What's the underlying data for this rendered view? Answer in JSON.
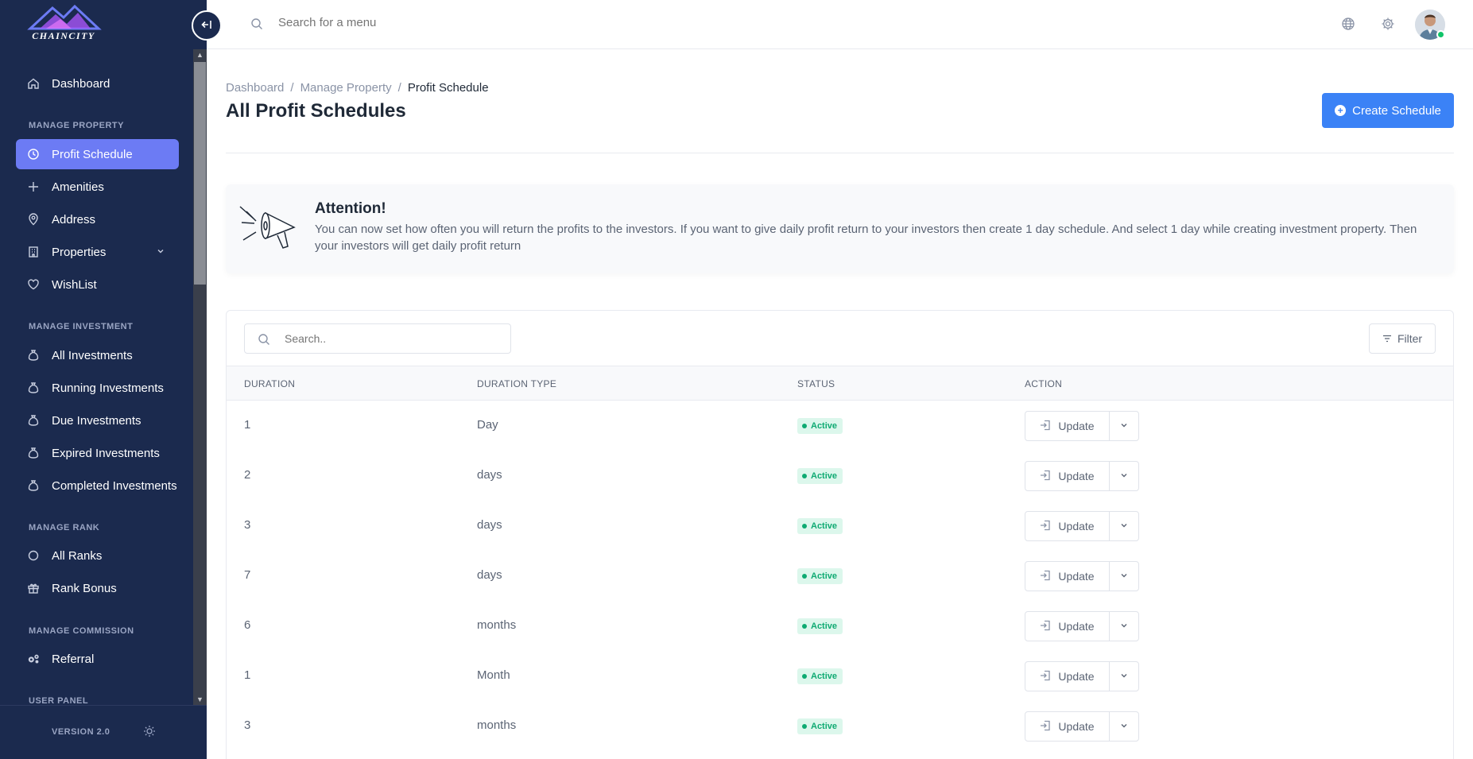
{
  "brand": {
    "logo_text": "CHAINCITY",
    "collapse_icon": "collapse-left-icon"
  },
  "topbar": {
    "search_placeholder": "Search for a menu",
    "icons": [
      "globe-icon",
      "gear-icon"
    ]
  },
  "sidebar": {
    "dashboard": "Dashboard",
    "sections": {
      "property": "MANAGE PROPERTY",
      "investment": "MANAGE INVESTMENT",
      "rank": "MANAGE RANK",
      "commission": "MANAGE COMMISSION",
      "user": "USER PANEL"
    },
    "property_items": [
      "Profit Schedule",
      "Amenities",
      "Address",
      "Properties",
      "WishList"
    ],
    "investment_items": [
      "All Investments",
      "Running Investments",
      "Due Investments",
      "Expired Investments",
      "Completed Investments"
    ],
    "rank_items": [
      "All Ranks",
      "Rank Bonus"
    ],
    "commission_items": [
      "Referral"
    ],
    "active_item": "Profit Schedule",
    "version": "VERSION 2.0"
  },
  "breadcrumb": [
    "Dashboard",
    "Manage Property",
    "Profit Schedule"
  ],
  "page": {
    "title": "All Profit Schedules",
    "create_label": "Create Schedule"
  },
  "attention": {
    "title": "Attention!",
    "text": "You can now set how often you will return the profits to the investors. If you want to give daily profit return to your investors then create 1 day schedule. And select 1 day while creating investment property. Then your investors will get daily profit return"
  },
  "table": {
    "search_placeholder": "Search..",
    "filter_label": "Filter",
    "columns": [
      "DURATION",
      "DURATION TYPE",
      "STATUS",
      "ACTION"
    ],
    "rows": [
      {
        "duration": "1",
        "type": "Day",
        "status": "Active"
      },
      {
        "duration": "2",
        "type": "days",
        "status": "Active"
      },
      {
        "duration": "3",
        "type": "days",
        "status": "Active"
      },
      {
        "duration": "7",
        "type": "days",
        "status": "Active"
      },
      {
        "duration": "6",
        "type": "months",
        "status": "Active"
      },
      {
        "duration": "1",
        "type": "Month",
        "status": "Active"
      },
      {
        "duration": "3",
        "type": "months",
        "status": "Active"
      }
    ],
    "update_label": "Update"
  },
  "colors": {
    "sidebar_bg": "#1b2a4e",
    "active_item": "#6c7bf4",
    "primary": "#3b82f6",
    "success": "#0eaa72"
  }
}
